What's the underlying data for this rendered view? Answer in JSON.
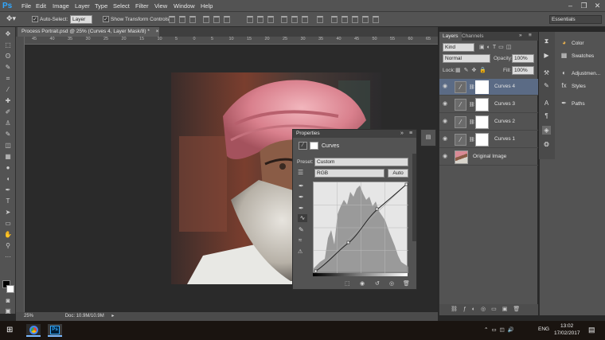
{
  "menubar": {
    "logo": "Ps",
    "items": [
      "File",
      "Edit",
      "Image",
      "Layer",
      "Type",
      "Select",
      "Filter",
      "View",
      "Window",
      "Help"
    ],
    "controls": [
      "–",
      "❐",
      "✕"
    ]
  },
  "options_bar": {
    "auto_select_label": "Auto-Select:",
    "auto_select_value": "Layer",
    "transform_label": "Show Transform Controls",
    "workspace": "Essentials"
  },
  "document": {
    "tab_title": "Process Portrait.psd @ 25% (Curves 4, Layer Mask/8) *",
    "tab_close": "×",
    "ruler_top": [
      "45",
      "40",
      "35",
      "30",
      "25",
      "20",
      "15",
      "10",
      "5",
      "0",
      "5",
      "10",
      "15",
      "20",
      "25",
      "30",
      "35",
      "40",
      "45",
      "50",
      "55",
      "60",
      "65"
    ],
    "zoom": "25%",
    "doc_size": "Doc: 10.9M/10.9M"
  },
  "properties": {
    "title": "Properties",
    "type_label": "Curves",
    "preset_label": "Preset:",
    "preset_value": "Custom",
    "channel_value": "RGB",
    "auto_button": "Auto"
  },
  "layers_panel": {
    "tabs": [
      "Layers",
      "Channels"
    ],
    "kind": "Kind",
    "blend_mode": "Normal",
    "opacity_label": "Opacity:",
    "opacity_value": "100%",
    "lock_label": "Lock:",
    "fill_label": "Fill:",
    "fill_value": "100%",
    "layers": [
      {
        "name": "Curves 4",
        "selected": true
      },
      {
        "name": "Curves 3",
        "selected": false
      },
      {
        "name": "Curves 2",
        "selected": false
      },
      {
        "name": "Curves 1",
        "selected": false
      },
      {
        "name": "Original Image",
        "selected": false
      }
    ]
  },
  "right_dock": {
    "items": [
      "Color",
      "Swatches",
      "Adjustmen...",
      "Styles",
      "Paths"
    ]
  },
  "taskbar": {
    "language": "ENG",
    "time": "13:02",
    "date": "17/02/2017"
  },
  "colors": {
    "accent": "#31a8ff",
    "selected_layer": "#5b6b85",
    "panel": "#535353"
  }
}
